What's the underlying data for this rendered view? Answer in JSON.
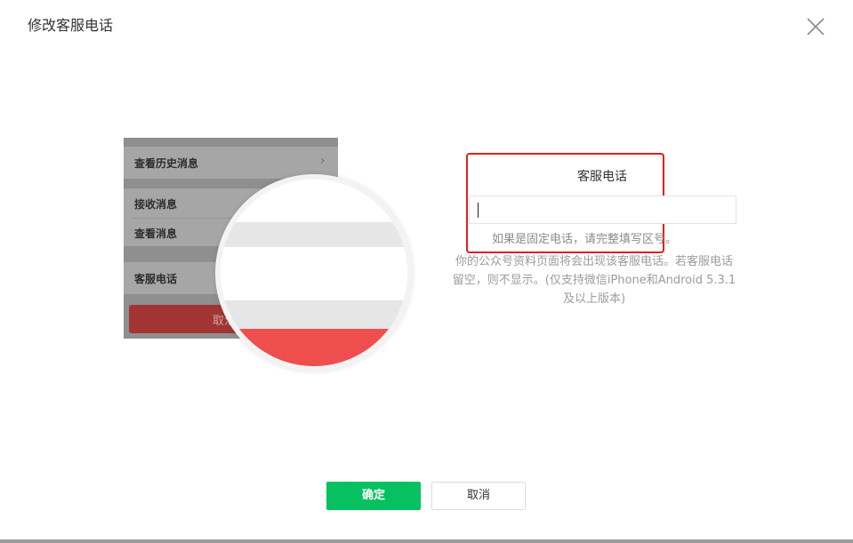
{
  "dialog": {
    "title": "修改客服电话",
    "close_icon": "close-icon"
  },
  "illustration": {
    "rows": [
      {
        "label": "查看历史消息"
      },
      {
        "label": "接收消息"
      },
      {
        "label": "查看消息"
      },
      {
        "label": "客服电话"
      }
    ],
    "cancel_label": "取消",
    "chevron_icon": "chevron-right-icon"
  },
  "form": {
    "label": "客服电话",
    "input_value": "",
    "input_placeholder": "",
    "hint": "如果是固定电话，请完整填写区号。",
    "description": "你的公众号资料页面将会出现该客服电话。若客服电话留空，则不显示。(仅支持微信iPhone和Android 5.3.1及以上版本)"
  },
  "footer": {
    "confirm_label": "确定",
    "cancel_label": "取消"
  },
  "colors": {
    "primary": "#07c160",
    "highlight": "#e0201c",
    "danger_band": "#ee4e4e"
  }
}
